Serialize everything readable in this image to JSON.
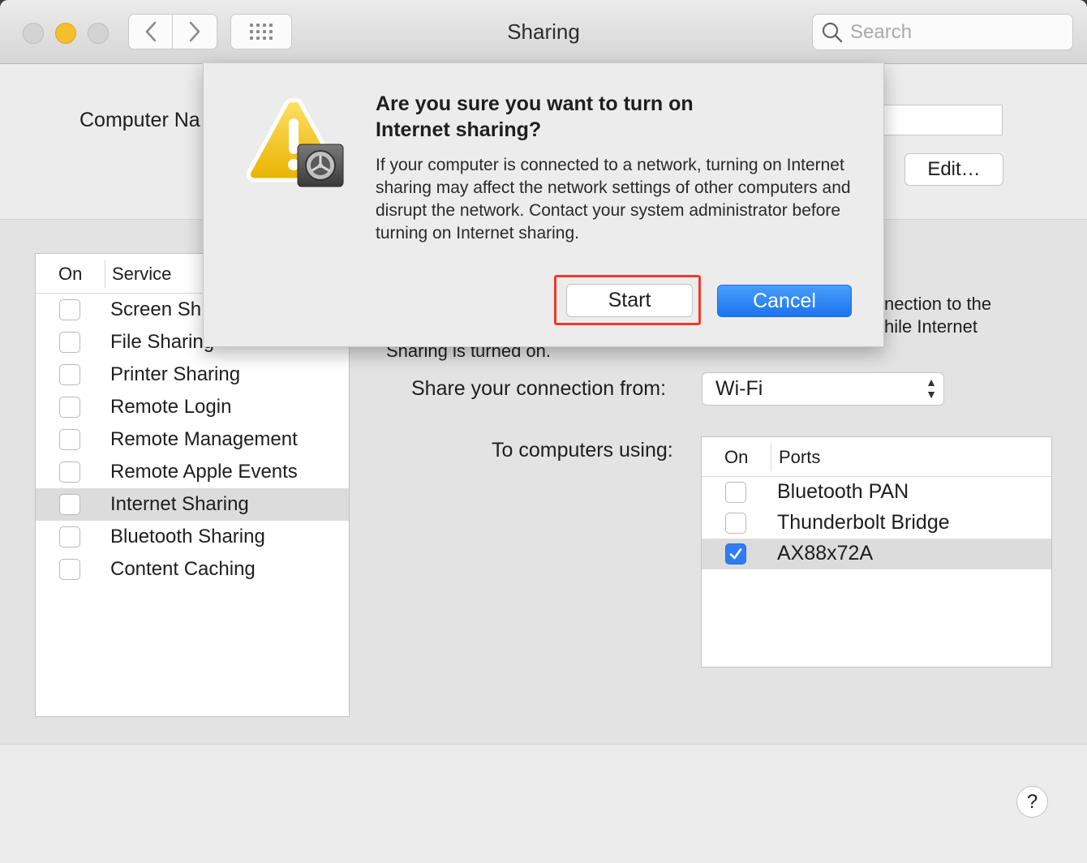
{
  "window": {
    "title": "Sharing",
    "search_placeholder": "Search"
  },
  "header": {
    "computer_name_label": "Computer Na",
    "edit_button": "Edit…"
  },
  "services": {
    "col_on": "On",
    "col_service": "Service",
    "items": [
      {
        "label": "Screen Sh",
        "checked": false
      },
      {
        "label": "File Sharing",
        "checked": false
      },
      {
        "label": "Printer Sharing",
        "checked": false
      },
      {
        "label": "Remote Login",
        "checked": false
      },
      {
        "label": "Remote Management",
        "checked": false
      },
      {
        "label": "Remote Apple Events",
        "checked": false
      },
      {
        "label": "Internet Sharing",
        "checked": false,
        "selected": true
      },
      {
        "label": "Bluetooth Sharing",
        "checked": false
      },
      {
        "label": "Content Caching",
        "checked": false
      }
    ]
  },
  "detail": {
    "partial_line1": "nection to the",
    "partial_line2": "hile Internet",
    "partial_line3": "Sharing is turned on.",
    "share_from_label": "Share your connection from:",
    "share_from_value": "Wi-Fi",
    "to_computers_label": "To computers using:",
    "ports_col_on": "On",
    "ports_col_ports": "Ports",
    "ports": [
      {
        "label": "Bluetooth PAN",
        "checked": false
      },
      {
        "label": "Thunderbolt Bridge",
        "checked": false
      },
      {
        "label": "AX88x72A",
        "checked": true
      }
    ],
    "help": "?"
  },
  "dialog": {
    "title_line1": "Are you sure you want to turn on",
    "title_line2": "Internet sharing?",
    "message": "If your computer is connected to a network, turning on Internet sharing may affect the network settings of other computers and disrupt the network. Contact your system administrator before turning on Internet sharing.",
    "start_button": "Start",
    "cancel_button": "Cancel",
    "accent_color": "#1c74ef",
    "highlight_color": "#f23a2a"
  }
}
